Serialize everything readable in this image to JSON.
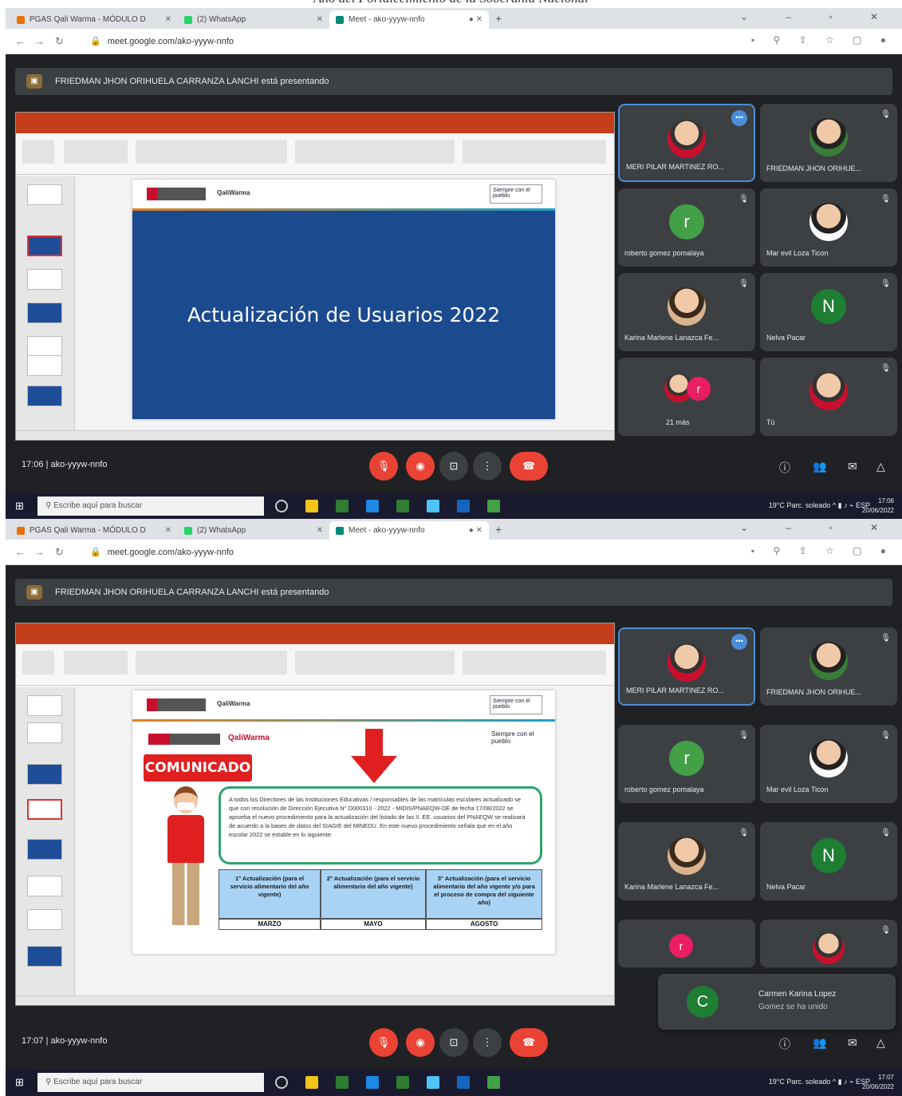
{
  "page_header": "Año del Fortalecimiento de la Soberanía Nacional",
  "browser": {
    "tabs": [
      {
        "title": "PGAS Qali Warma - MÓDULO D",
        "fav_color": "#e8710a"
      },
      {
        "title": "(2) WhatsApp",
        "fav_color": "#25d366"
      },
      {
        "title": "Meet - ako-yyyw-nnfo",
        "fav_color": "#00897b"
      }
    ],
    "url": "meet.google.com/ako-yyyw-nnfo"
  },
  "meet": {
    "presenter_banner": "FRIEDMAN JHON ORIHUELA CARRANZA LANCHI está presentando",
    "participants": [
      {
        "name": "MERI PILAR MARTINEZ RO...",
        "kind": "photo",
        "active": true
      },
      {
        "name": "FRIEDMAN JHON ORIHUE...",
        "kind": "photo",
        "active": false
      },
      {
        "name": "roberto gomez pomalaya",
        "kind": "initial",
        "initial": "r",
        "color": "#43a047",
        "active": false
      },
      {
        "name": "Mar evil Loza Ticon",
        "kind": "photo",
        "active": false
      },
      {
        "name": "Karina Marlene Lanazca Fe...",
        "kind": "photo",
        "active": false
      },
      {
        "name": "Nelva Pacar",
        "kind": "initial",
        "initial": "N",
        "color": "#1e7e34",
        "active": false
      },
      {
        "name": "21 más",
        "kind": "group",
        "active": false
      },
      {
        "name": "Tú",
        "kind": "photo",
        "active": false
      }
    ]
  },
  "screenshots": [
    {
      "time": "17:06",
      "meeting_code": "ako-yyyw-nnfo",
      "clock": "17:06",
      "date": "20/06/2022"
    },
    {
      "time": "17:07",
      "meeting_code": "ako-yyyw-nnfo",
      "clock": "17:07",
      "date": "20/06/2022"
    }
  ],
  "slide1": {
    "title": "Actualización de Usuarios 2022",
    "logo_program": "QaliWarma",
    "logo_sp": "Siempre con el pueblo"
  },
  "slide2": {
    "logo_program": "QaliWarma",
    "logo_sp": "Siempre con el pueblo",
    "comunicado": "COMUNICADO",
    "notice_text": "A todos los Directores de las Instituciones Educativas / responsables de las matrículas escolares actualizado se que con resolución de Dirección Ejecutiva N° D000310 - 2022 - MIDIS/PNAEQW-DE de fecha 17/08/2022 se aprueba el nuevo procedimiento para la actualización del listado de las II. EE. usuarios del PNAEQW se realizará de acuerdo a la bases de datos del SIAGIE del MINEDU. En este nuevo procedimiento señala que en el año escolar 2022 se estable en lo siguiente:",
    "columns": [
      {
        "heading": "1° Actualización (para el servicio alimentario del año vigente)",
        "month": "MARZO"
      },
      {
        "heading": "2° Actualización (para el servicio alimentario del año vigente)",
        "month": "MAYO"
      },
      {
        "heading": "3° Actualización (para el servicio alimentario del año vigente y/o para el proceso de compra del siguiente año)",
        "month": "AGOSTO"
      }
    ]
  },
  "toast": {
    "initial": "C",
    "name": "Carmen Karina Lopez",
    "status": "Gomez se ha unido"
  },
  "taskbar": {
    "search_placeholder": "Escribe aquí para buscar",
    "weather": "19°C Parc. soleado",
    "lang": "ESP"
  }
}
